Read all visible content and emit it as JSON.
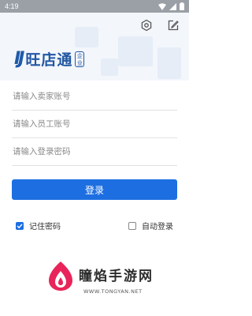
{
  "status_bar": {
    "time": "4:19"
  },
  "header": {
    "settings_icon": "gear-icon",
    "edit_icon": "edit-icon"
  },
  "logo": {
    "mark": "IJ",
    "text": "旺店通",
    "badge": "企业"
  },
  "form": {
    "seller_account_placeholder": "请输入卖家账号",
    "employee_account_placeholder": "请输入员工账号",
    "password_placeholder": "请输入登录密码"
  },
  "login_button": {
    "label": "登录"
  },
  "options": {
    "remember_password": {
      "label": "记住密码",
      "checked": true
    },
    "auto_login": {
      "label": "自动登录",
      "checked": false
    }
  },
  "watermark": {
    "name": "瞳焰手游网",
    "url": "WWW.TONGYAN.NET"
  },
  "colors": {
    "primary": "#1d6fe1",
    "brand": "#2257a3",
    "status_bar": "#9aa0a6"
  }
}
